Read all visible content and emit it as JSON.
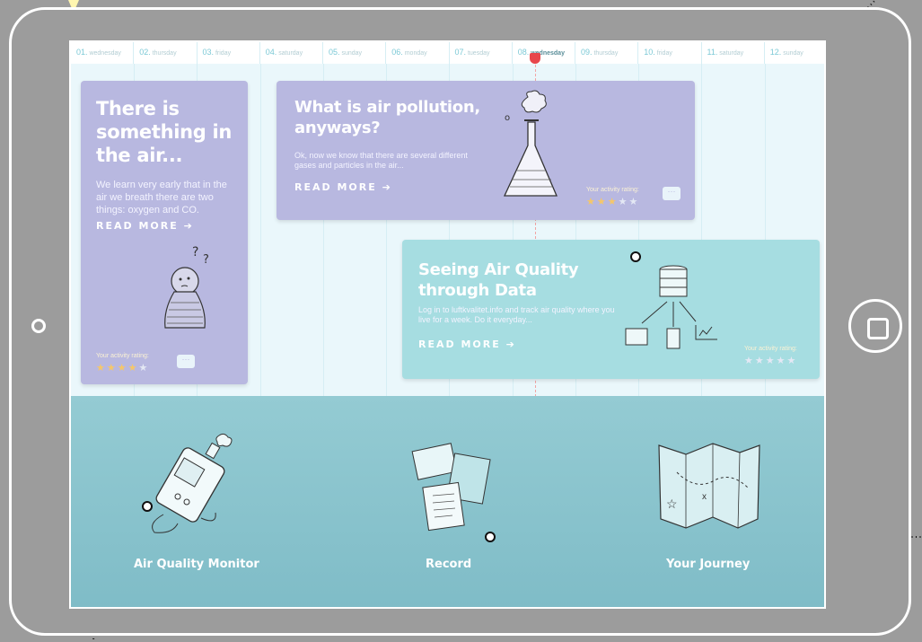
{
  "timeline": {
    "days": [
      {
        "num": "01.",
        "name": "wednesday"
      },
      {
        "num": "02.",
        "name": "thursday"
      },
      {
        "num": "03.",
        "name": "friday"
      },
      {
        "num": "04.",
        "name": "saturday"
      },
      {
        "num": "05.",
        "name": "sunday"
      },
      {
        "num": "06.",
        "name": "monday"
      },
      {
        "num": "07.",
        "name": "tuesday"
      },
      {
        "num": "08.",
        "name": "wednesday"
      },
      {
        "num": "09.",
        "name": "thursday"
      },
      {
        "num": "10.",
        "name": "friday"
      },
      {
        "num": "11.",
        "name": "saturday"
      },
      {
        "num": "12.",
        "name": "sunday"
      }
    ]
  },
  "cards": {
    "air": {
      "title": "There is something in the air...",
      "text": "We learn very early that in the air we breath there are two things: oxygen and CO.",
      "more": "READ MORE ➔",
      "rating_label": "Your activity rating:",
      "stars": "★★★★★"
    },
    "pollution": {
      "title": "What is air pollution, anyways?",
      "text": "Ok, now we know that there are several different gases and particles in the air...",
      "more": "READ MORE ➔",
      "rating_label": "Your activity rating:",
      "stars": "★★★★★"
    },
    "quality": {
      "title": "Seeing Air Quality through Data",
      "text": "Log in to luftkvalitet.info and track air quality where you live for a week. Do it everyday...",
      "more": "READ MORE ➔",
      "rating_label": "Your activity rating:",
      "stars": "★★★★★"
    }
  },
  "bottom": {
    "monitor": "Air Quality Monitor",
    "record": "Record",
    "journey": "Your Journey"
  },
  "colors": {
    "purple_card": "#b8b8e0",
    "teal_card": "#a6dde1",
    "star_filled": "#f5c76a",
    "star_empty": "#e4e8f4",
    "now_marker": "#e8464b"
  },
  "ratings": {
    "air": {
      "filled": 4,
      "max": 5
    },
    "pollution": {
      "filled": 3,
      "max": 5
    },
    "quality": {
      "filled": 0,
      "max": 5
    }
  }
}
